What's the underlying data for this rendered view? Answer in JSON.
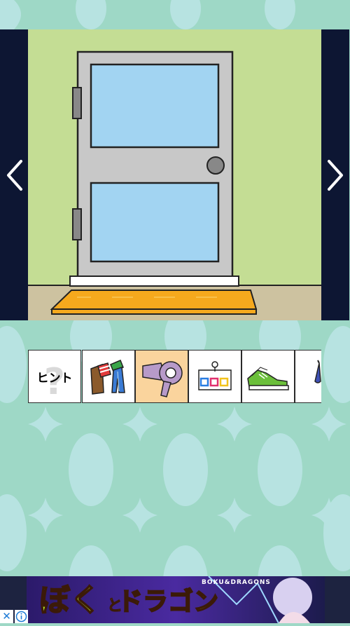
{
  "colors": {
    "background": "#9ed8c6",
    "pattern": "#b7e3e1",
    "scene_wall": "#c4dd94",
    "scene_floor": "#cdc2a0",
    "door": "#c8c8c8",
    "window": "#a2d4f2",
    "mat": "#f6a91d",
    "nav_bar": "#0d1633",
    "selected_slot": "#fad49d"
  },
  "navigation": {
    "left_icon": "chevron-left-icon",
    "right_icon": "chevron-right-icon"
  },
  "scene": {
    "objects": [
      "door",
      "door-window-top",
      "door-window-bottom",
      "door-knob",
      "door-hinge-top",
      "door-hinge-bottom",
      "door-step",
      "door-mat"
    ]
  },
  "inventory": {
    "items": [
      {
        "name": "hint",
        "label": "ヒント",
        "icon": "hint-icon",
        "selected": false
      },
      {
        "name": "clothes",
        "icon": "clothes-icon",
        "selected": false
      },
      {
        "name": "hair-dryer",
        "icon": "hair-dryer-icon",
        "selected": true
      },
      {
        "name": "color-code-card",
        "icon": "color-card-icon",
        "selected": false
      },
      {
        "name": "sneaker",
        "icon": "sneaker-icon",
        "selected": false
      },
      {
        "name": "umbrella",
        "icon": "umbrella-icon",
        "selected": false
      }
    ]
  },
  "ad": {
    "brand": "BOKU&DRAGONS",
    "title_part1": "ぼく",
    "title_part2": "と",
    "title_part3": "ドラゴン",
    "close_icon": "close-icon",
    "info_icon": "info-icon"
  }
}
